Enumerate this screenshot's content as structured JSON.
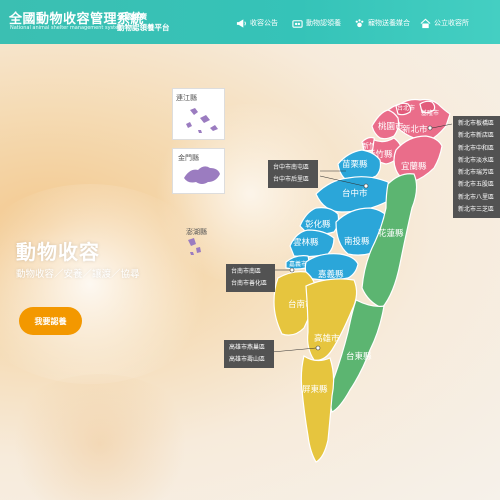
{
  "header": {
    "title": "全國動物收容管理系統",
    "subtitle": "National animal shelter management system",
    "tagline_1": "全國推廣",
    "tagline_2": "動物認領養平台",
    "nav": [
      {
        "label": "收容公告",
        "icon": "megaphone-icon"
      },
      {
        "label": "動物認領養",
        "icon": "animal-adoption-icon"
      },
      {
        "label": "寵物送養媒合",
        "icon": "pet-matching-icon"
      },
      {
        "label": "公立收容所",
        "icon": "shelter-house-icon"
      }
    ]
  },
  "hero": {
    "title": "動物收容",
    "subtitle": "動物收容／安養／讓渡／協尋",
    "cta": "我要認養"
  },
  "map": {
    "regions": {
      "keelung": "基隆市",
      "taipei": "台北市",
      "newtaipei": "新北市",
      "taoyuan": "桃園市",
      "hsinchu_city": "新竹市",
      "hsinchu_county": "新竹縣",
      "yilan": "宜蘭縣",
      "miaoli": "苗栗縣",
      "taichung": "台中市",
      "changhua": "彰化縣",
      "nantou": "南投縣",
      "yunlin": "雲林縣",
      "chiayi_city": "嘉義市",
      "chiayi_county": "嘉義縣",
      "hualien": "花蓮縣",
      "tainan": "台南市",
      "kaohsiung": "高雄市",
      "taitung": "台東縣",
      "pingtung": "屏東縣",
      "lienchiang": "連江縣",
      "kinmen": "金門縣",
      "penghu": "澎湖縣"
    },
    "colors": {
      "north": "#ea6d8a",
      "central": "#2ba6d9",
      "south": "#e6c53e",
      "east": "#5cb571",
      "islet": "#9b7cc0"
    },
    "taichung_districts": [
      "台中市南屯區",
      "台中市后里區"
    ],
    "tainan_districts": [
      "台南市南區",
      "台南市善化區"
    ],
    "kaohsiung_districts": [
      "高雄市燕巢區",
      "高雄市壽山區"
    ],
    "newtaipei_districts": [
      "新北市板橋區",
      "新北市新店區",
      "新北市中和區",
      "新北市淡水區",
      "新北市瑞芳區",
      "新北市五股區",
      "新北市八里區",
      "新北市三芝區"
    ]
  }
}
